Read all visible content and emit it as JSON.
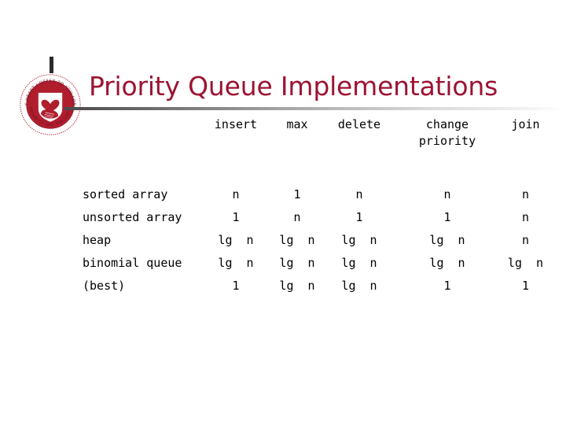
{
  "slide": {
    "title": "Priority Queue Implementations",
    "accent_color": "#9c1432",
    "background_color": "#ffffff",
    "rule_color_start": "#4a4a4a",
    "rule_color_end": "#ffffff"
  },
  "logo": {
    "name": "calvin-seal-logo",
    "seal_text_top": "MY HEART I OFFER TO YOU LORD",
    "seal_text_bottom": "PROMPTLY AND SINCERELY",
    "seal_color": "#b01e2e",
    "emblem": "heart-in-hand"
  },
  "table": {
    "columns": [
      {
        "id": "implementation",
        "label": ""
      },
      {
        "id": "insert",
        "label": "insert"
      },
      {
        "id": "max",
        "label": "max"
      },
      {
        "id": "delete",
        "label": "delete"
      },
      {
        "id": "change_priority",
        "label": "change",
        "label_line2": "priority"
      },
      {
        "id": "join",
        "label": "join"
      }
    ],
    "rows": [
      {
        "label": "sorted array",
        "cells": [
          "n",
          "1",
          "n",
          "n",
          "n"
        ]
      },
      {
        "label": "unsorted array",
        "cells": [
          "1",
          "n",
          "1",
          "1",
          "n"
        ]
      },
      {
        "label": "heap",
        "cells": [
          "lg  n",
          "lg  n",
          "lg  n",
          "lg  n",
          "n"
        ]
      },
      {
        "label": "binomial queue",
        "cells": [
          "lg  n",
          "lg  n",
          "lg  n",
          "lg  n",
          "lg  n"
        ]
      },
      {
        "label": "(best)",
        "cells": [
          "1",
          "lg  n",
          "lg  n",
          "1",
          "1"
        ]
      }
    ]
  }
}
